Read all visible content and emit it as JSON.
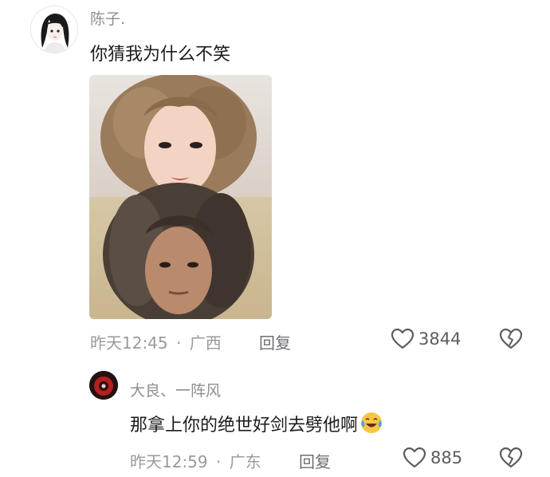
{
  "comment": {
    "username": "陈子.",
    "text": "你猜我为什么不笑",
    "timestamp": "昨天12:45",
    "separator": "·",
    "location": "广西",
    "reply_label": "回复",
    "like_count": "3844",
    "icons": {
      "like": "heart-outline-icon",
      "dislike": "broken-heart-icon"
    }
  },
  "reply": {
    "username": "大良、一阵风",
    "text": "那拿上你的绝世好剑去劈他啊",
    "emoji": "crying-laughing-emoji",
    "timestamp": "昨天12:59",
    "separator": "·",
    "location": "广东",
    "reply_label": "回复",
    "like_count": "885"
  },
  "colors": {
    "meta_gray": "#9a9a9f",
    "text_dark": "#1c1c1e",
    "emoji_yellow": "#f6c744"
  }
}
